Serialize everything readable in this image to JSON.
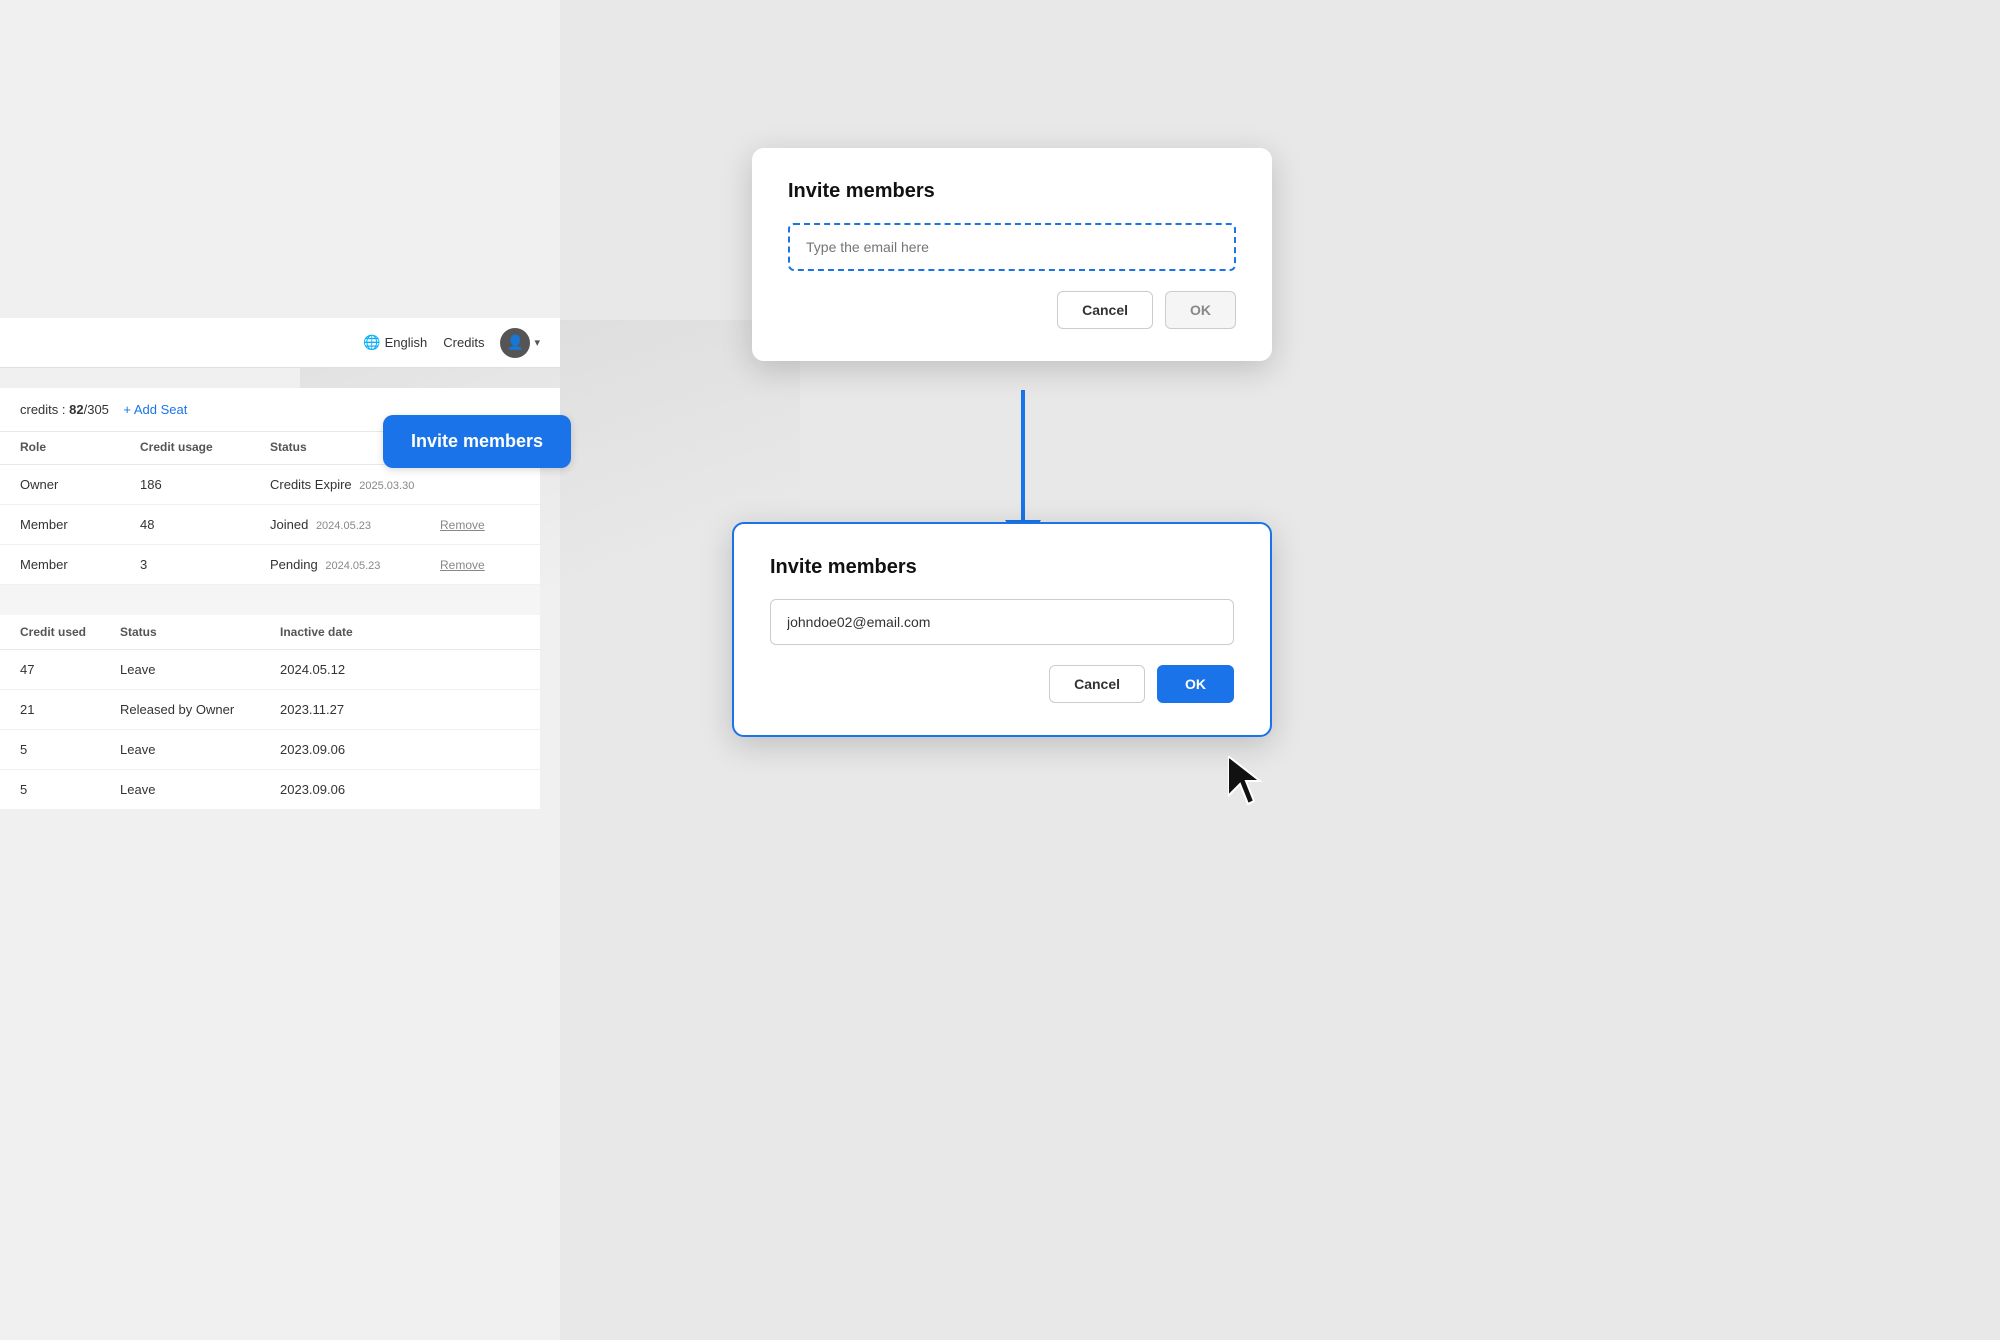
{
  "header": {
    "language": "English",
    "credits": "Credits",
    "avatar_initial": "👤"
  },
  "credits_bar": {
    "label": "credits :",
    "used": "82",
    "total": "305",
    "add_seat": "Add Seat"
  },
  "invite_button": {
    "label": "Invite members"
  },
  "members_table": {
    "headers": [
      "Role",
      "Credit usage",
      "Status",
      ""
    ],
    "rows": [
      {
        "role": "Owner",
        "credit_usage": "186",
        "status": "Credits Expire",
        "status_date": "2025.03.30",
        "action": ""
      },
      {
        "role": "Member",
        "credit_usage": "48",
        "status": "Joined",
        "status_date": "2024.05.23",
        "action": "Remove"
      },
      {
        "role": "Member",
        "credit_usage": "3",
        "status": "Pending",
        "status_date": "2024.05.23",
        "action": "Remove"
      }
    ]
  },
  "inactive_table": {
    "headers": [
      "Credit used",
      "Status",
      "Inactive date"
    ],
    "rows": [
      {
        "credit_used": "47",
        "status": "Leave",
        "inactive_date": "2024.05.12"
      },
      {
        "credit_used": "21",
        "status": "Released by Owner",
        "inactive_date": "2023.11.27"
      },
      {
        "credit_used": "5",
        "status": "Leave",
        "inactive_date": "2023.09.06"
      },
      {
        "credit_used": "5",
        "status": "Leave",
        "inactive_date": "2023.09.06"
      }
    ]
  },
  "modal_top": {
    "title": "Invite members",
    "email_placeholder": "Type the email here",
    "cancel_label": "Cancel",
    "ok_label": "OK"
  },
  "modal_bottom": {
    "title": "Invite members",
    "email_value": "johndoe02@email.com",
    "cancel_label": "Cancel",
    "ok_label": "OK"
  }
}
